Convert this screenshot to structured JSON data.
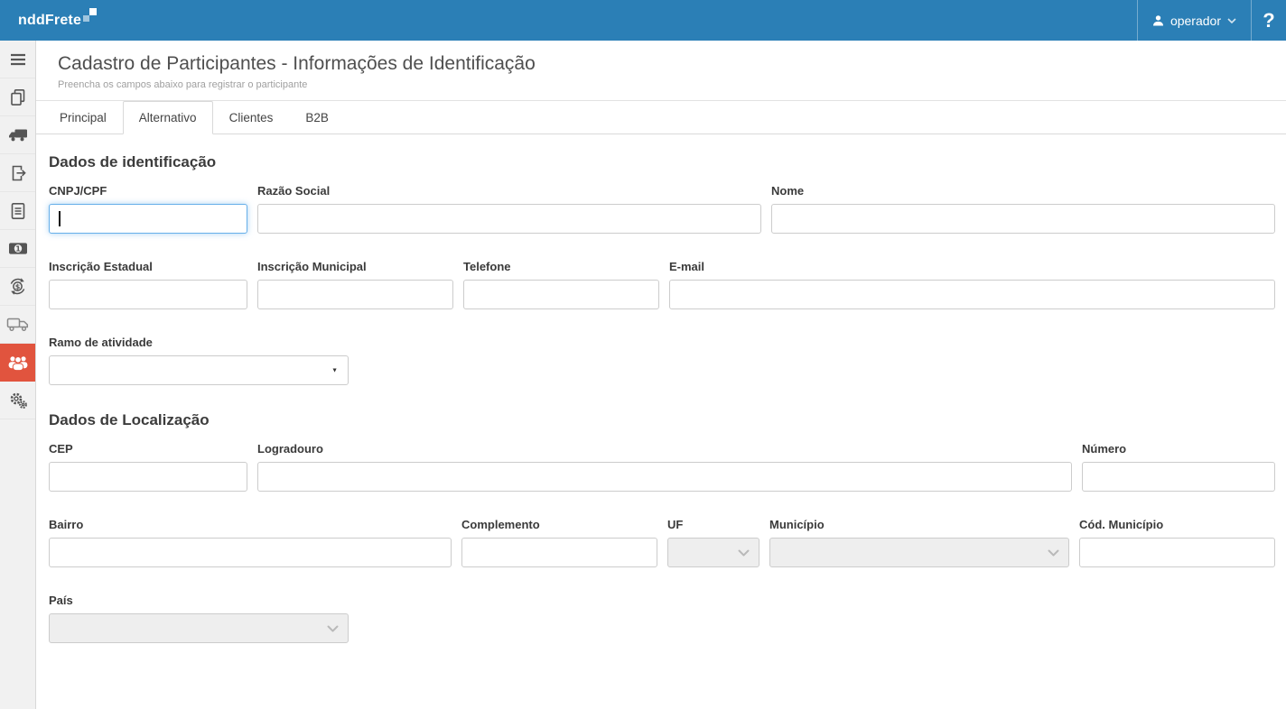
{
  "topbar": {
    "brand": "nddFrete",
    "user_label": "operador",
    "help_label": "?"
  },
  "sidebar": {
    "items": [
      {
        "icon": "hamburger-menu-icon",
        "active": false
      },
      {
        "icon": "copy-documents-icon",
        "active": false
      },
      {
        "icon": "truck-icon",
        "active": false
      },
      {
        "icon": "document-export-icon",
        "active": false
      },
      {
        "icon": "report-document-icon",
        "active": false
      },
      {
        "icon": "banknote-icon",
        "active": false
      },
      {
        "icon": "money-sync-icon",
        "active": false
      },
      {
        "icon": "truck-outline-icon",
        "active": false
      },
      {
        "icon": "users-group-icon",
        "active": true
      },
      {
        "icon": "gears-icon",
        "active": false
      }
    ]
  },
  "header": {
    "title": "Cadastro de Participantes - Informações de Identificação",
    "subtitle": "Preencha os campos abaixo para registrar o participante"
  },
  "tabs": {
    "items": [
      {
        "label": "Principal",
        "active": false
      },
      {
        "label": "Alternativo",
        "active": true
      },
      {
        "label": "Clientes",
        "active": false
      },
      {
        "label": "B2B",
        "active": false
      }
    ]
  },
  "form": {
    "sections": {
      "identificacao": {
        "heading": "Dados de identificação",
        "fields": {
          "cnpj_cpf": {
            "label": "CNPJ/CPF",
            "value": "",
            "type": "text",
            "focused": true
          },
          "razao_social": {
            "label": "Razão Social",
            "value": "",
            "type": "text"
          },
          "nome": {
            "label": "Nome",
            "value": "",
            "type": "text"
          },
          "inscricao_estadual": {
            "label": "Inscrição Estadual",
            "value": "",
            "type": "text"
          },
          "inscricao_municipal": {
            "label": "Inscrição Municipal",
            "value": "",
            "type": "text"
          },
          "telefone": {
            "label": "Telefone",
            "value": "",
            "type": "text"
          },
          "email": {
            "label": "E-mail",
            "value": "",
            "type": "text"
          },
          "ramo_atividade": {
            "label": "Ramo de atividade",
            "value": "",
            "type": "select",
            "disabled": false
          }
        }
      },
      "localizacao": {
        "heading": "Dados de Localização",
        "fields": {
          "cep": {
            "label": "CEP",
            "value": "",
            "type": "text"
          },
          "logradouro": {
            "label": "Logradouro",
            "value": "",
            "type": "text"
          },
          "numero": {
            "label": "Número",
            "value": "",
            "type": "text"
          },
          "bairro": {
            "label": "Bairro",
            "value": "",
            "type": "text"
          },
          "complemento": {
            "label": "Complemento",
            "value": "",
            "type": "text"
          },
          "uf": {
            "label": "UF",
            "value": "",
            "type": "select",
            "disabled": true
          },
          "municipio": {
            "label": "Município",
            "value": "",
            "type": "select",
            "disabled": true
          },
          "cod_municipio": {
            "label": "Cód. Município",
            "value": "",
            "type": "text"
          },
          "pais": {
            "label": "País",
            "value": "",
            "type": "select",
            "disabled": true
          }
        }
      }
    }
  },
  "colors": {
    "topbar_blue": "#2b7fb6",
    "sidebar_active_red": "#e1543e",
    "focus_border_blue": "#66afe9",
    "disabled_bg": "#eeeeee"
  }
}
